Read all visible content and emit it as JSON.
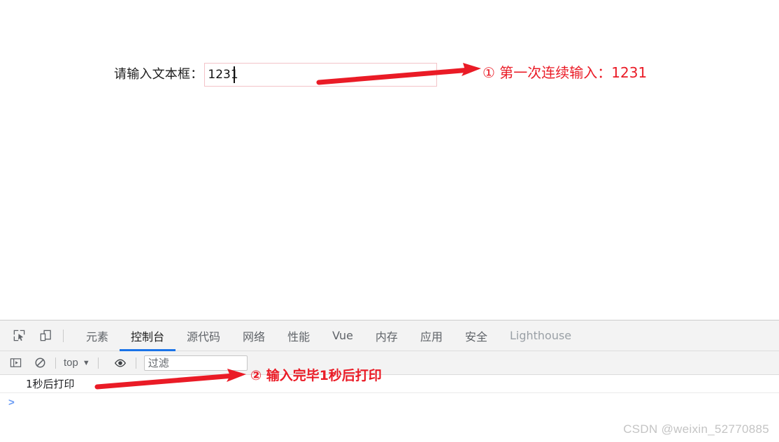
{
  "page": {
    "form": {
      "label": "请输入文本框：",
      "input_value": "1231",
      "input_placeholder": ""
    }
  },
  "annotations": [
    {
      "id": "annotation-1",
      "text": "① 第一次连续输入：1231",
      "color": "#ea1b26"
    },
    {
      "id": "annotation-2",
      "text": "② 输入完毕1秒后打印",
      "color": "#ea1b26"
    }
  ],
  "devtools": {
    "icons": {
      "inspect": "inspect-element-icon",
      "device": "device-toolbar-icon"
    },
    "tabs": [
      {
        "label": "元素",
        "active": false,
        "dim": false
      },
      {
        "label": "控制台",
        "active": true,
        "dim": false
      },
      {
        "label": "源代码",
        "active": false,
        "dim": false
      },
      {
        "label": "网络",
        "active": false,
        "dim": false
      },
      {
        "label": "性能",
        "active": false,
        "dim": false
      },
      {
        "label": "Vue",
        "active": false,
        "dim": false
      },
      {
        "label": "内存",
        "active": false,
        "dim": false
      },
      {
        "label": "应用",
        "active": false,
        "dim": false
      },
      {
        "label": "安全",
        "active": false,
        "dim": false
      },
      {
        "label": "Lighthouse",
        "active": false,
        "dim": true
      }
    ],
    "toolbar": {
      "sidebar_toggle_icon": "console-sidebar-icon",
      "clear_console_icon": "clear-console-icon",
      "context_label": "top",
      "context_caret": "▼",
      "eye_icon": "eye-icon",
      "filter_placeholder": "过滤",
      "filter_value": ""
    },
    "console": {
      "messages": [
        {
          "text": "1秒后打印"
        }
      ],
      "prompt_symbol": ">"
    },
    "accent_color": "#1a73e8"
  },
  "watermark": {
    "text": "CSDN @weixin_52770885"
  }
}
